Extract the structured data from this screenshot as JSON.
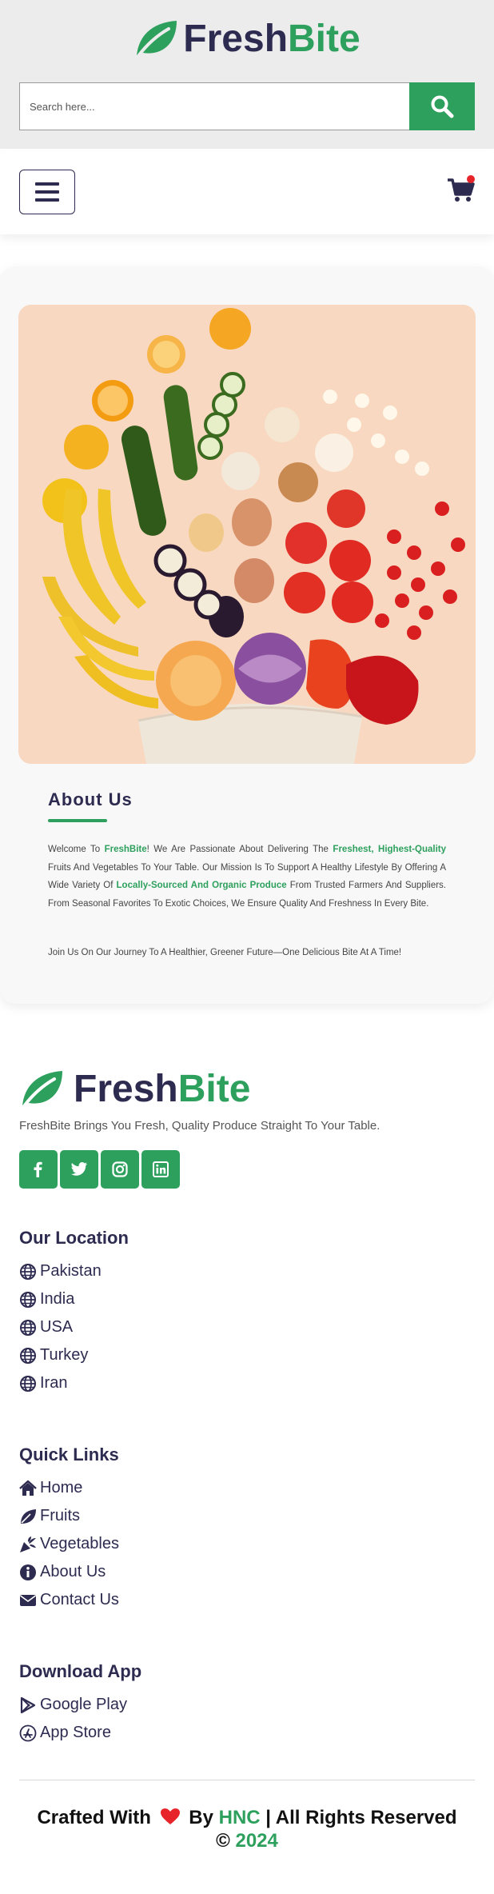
{
  "brand": {
    "name_part1": "Fresh",
    "name_part2": "Bite"
  },
  "search": {
    "placeholder": "Search here..."
  },
  "about": {
    "title": "About Us",
    "p1_a": "Welcome To ",
    "p1_b": "FreshBite",
    "p1_c": "! We Are Passionate About Delivering The ",
    "p1_d": "Freshest, Highest-Quality",
    "p1_e": " Fruits And Vegetables To Your Table. Our Mission Is To Support A Healthy Lifestyle By Offering A Wide Variety Of ",
    "p1_f": "Locally-Sourced And Organic Produce",
    "p1_g": " From Trusted Farmers And Suppliers. From Seasonal Favorites To Exotic Choices, We Ensure Quality And Freshness In Every Bite.",
    "p2": "Join Us On Our Journey To A Healthier, Greener Future—One Delicious Bite At A Time!"
  },
  "footer": {
    "tagline": "FreshBite Brings You Fresh, Quality Produce Straight To Your Table.",
    "social": [
      "facebook-icon",
      "twitter-icon",
      "instagram-icon",
      "linkedin-icon"
    ],
    "location": {
      "title": "Our Location",
      "items": [
        "Pakistan",
        "India",
        "USA",
        "Turkey",
        "Iran"
      ]
    },
    "quick_links": {
      "title": "Quick Links",
      "items": [
        "Home",
        "Fruits",
        "Vegetables",
        "About Us",
        "Contact Us"
      ]
    },
    "download": {
      "title": "Download App",
      "items": [
        "Google Play",
        "App Store"
      ]
    },
    "credits": {
      "a": "Crafted With",
      "b": "By",
      "c": "HNC",
      "d": "| All Rights Reserved",
      "e": "©",
      "f": "2024"
    }
  },
  "colors": {
    "brand_green": "#2ea05d",
    "brand_navy": "#2d2b50",
    "cart_dot": "#e8242b",
    "heart": "#e8242b"
  }
}
